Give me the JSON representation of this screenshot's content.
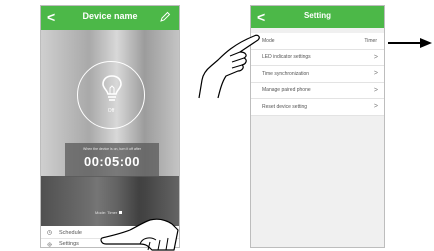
{
  "device_screen": {
    "title": "Device name",
    "bulb_state": "Off",
    "timer_caption": "When the device is on, turn it off after",
    "timer_value": "00:05:00",
    "mode_status": "Mode: Timer",
    "menu": [
      {
        "label": "Schedule",
        "icon": "clock-icon"
      },
      {
        "label": "Settings",
        "icon": "gear-icon"
      }
    ]
  },
  "setting_screen": {
    "title": "Setting",
    "rows": [
      {
        "label": "Mode",
        "value": "Timer"
      },
      {
        "label": "LED indicator settings",
        "value": ">"
      },
      {
        "label": "Time synchronization",
        "value": ">"
      },
      {
        "label": "Manage paired phone",
        "value": ">"
      },
      {
        "label": "Reset device setting",
        "value": ">"
      }
    ]
  },
  "colors": {
    "header_green": "#4cb848",
    "arrow": "#000000"
  }
}
